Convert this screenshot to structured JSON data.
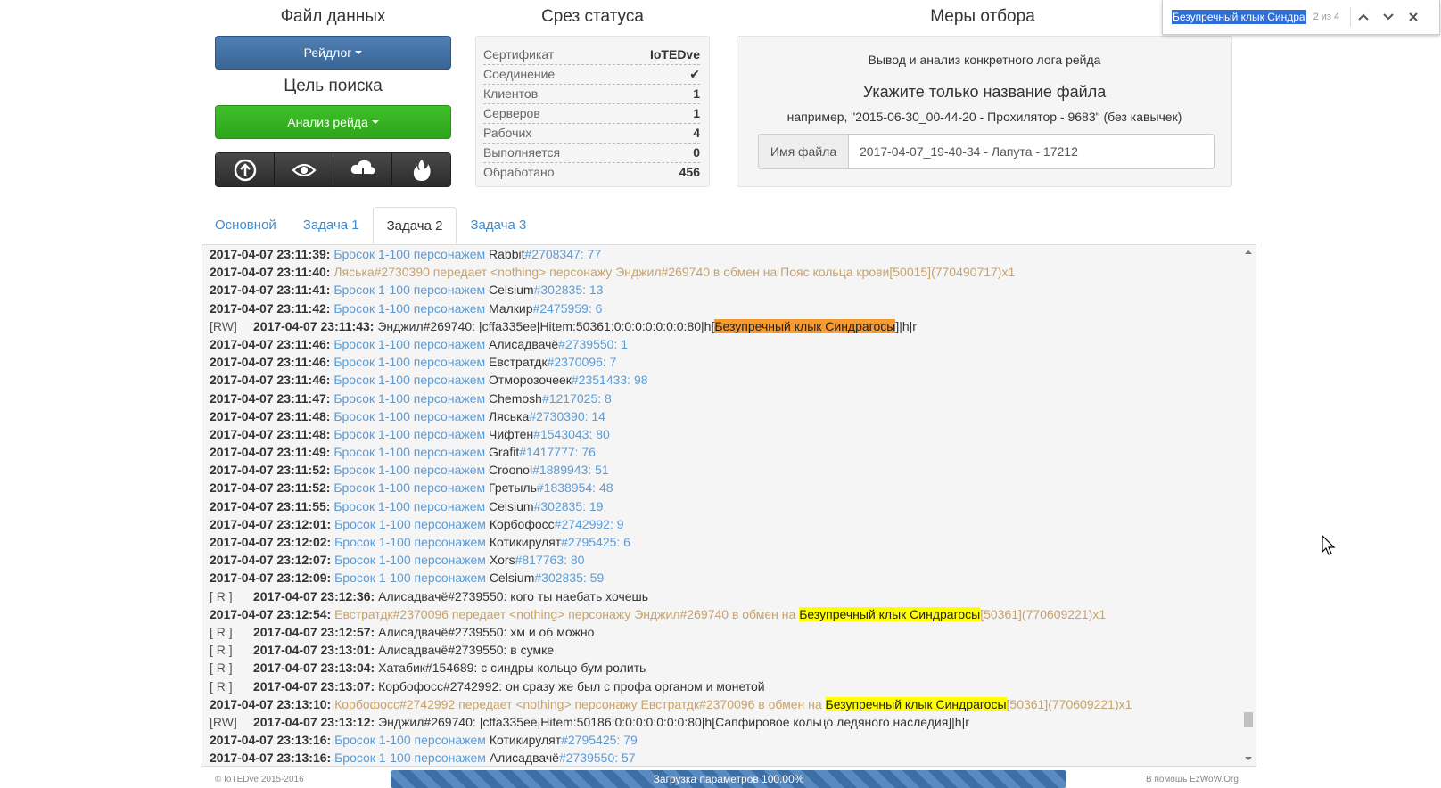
{
  "findbar": {
    "query": "Безупречный клык Синдра",
    "count": "2 из 4"
  },
  "left": {
    "data_title": "Файл данных",
    "data_button": "Рейдлог",
    "search_title": "Цель поиска",
    "search_button": "Анализ рейда",
    "icons": [
      "upload-icon",
      "eye-icon",
      "cloud-download-icon",
      "fire-icon"
    ]
  },
  "status": {
    "title": "Срез статуса",
    "rows": [
      {
        "label": "Сертификат",
        "value": "IoTEDve"
      },
      {
        "label": "Соединение",
        "value": "✔"
      },
      {
        "label": "Клиентов",
        "value": "1"
      },
      {
        "label": "Серверов",
        "value": "1"
      },
      {
        "label": "Рабочих",
        "value": "4"
      },
      {
        "label": "Выполняется",
        "value": "0"
      },
      {
        "label": "Обработано",
        "value": "456"
      }
    ]
  },
  "filter": {
    "title": "Меры отбора",
    "desc": "Вывод и анализ конкретного лога рейда",
    "heading": "Укажите только название файла",
    "example": "например, \"2015-06-30_00-44-20 - Прохилятор - 9683\" (без кавычек)",
    "input_label": "Имя файла",
    "input_value": "2017-04-07_19-40-34 - Лапута - 17212"
  },
  "tabs": [
    "Основной",
    "Задача 1",
    "Задача 2",
    "Задача 3"
  ],
  "log": [
    {
      "tag": "",
      "ts": "2017-04-07 23:11:39:",
      "parts": [
        {
          "c": "blue",
          "t": " Бросок 1-100 персонажем "
        },
        {
          "c": "dark",
          "t": "Rabbit"
        },
        {
          "c": "blue",
          "t": "#2708347: 77"
        }
      ]
    },
    {
      "tag": "",
      "ts": "2017-04-07 23:11:40:",
      "parts": [
        {
          "c": "tan",
          "t": " Ляська#2730390 передает <nothing> персонажу Энджил#269740 в обмен на "
        },
        {
          "c": "tan",
          "t": "Пояс кольца крови[50015](770490717)x1"
        }
      ]
    },
    {
      "tag": "",
      "ts": "2017-04-07 23:11:41:",
      "parts": [
        {
          "c": "blue",
          "t": " Бросок 1-100 персонажем "
        },
        {
          "c": "dark",
          "t": "Celsium"
        },
        {
          "c": "blue",
          "t": "#302835: 13"
        }
      ]
    },
    {
      "tag": "",
      "ts": "2017-04-07 23:11:42:",
      "parts": [
        {
          "c": "blue",
          "t": " Бросок 1-100 персонажем "
        },
        {
          "c": "dark",
          "t": "Малкир"
        },
        {
          "c": "blue",
          "t": "#2475959: 6"
        }
      ]
    },
    {
      "tag": "[RW]",
      "ts": "2017-04-07 23:11:43:",
      "parts": [
        {
          "c": "dark",
          "t": " Энджил#269740: |cffa335ee|Hitem:50361:0:0:0:0:0:0:0:80|h["
        },
        {
          "c": "hl-orange",
          "t": "Безупречный клык Синдрагосы"
        },
        {
          "c": "dark",
          "t": "]|h|r"
        }
      ]
    },
    {
      "tag": "",
      "ts": "2017-04-07 23:11:46:",
      "parts": [
        {
          "c": "blue",
          "t": " Бросок 1-100 персонажем "
        },
        {
          "c": "dark",
          "t": "Алисадвачё"
        },
        {
          "c": "blue",
          "t": "#2739550: 1"
        }
      ]
    },
    {
      "tag": "",
      "ts": "2017-04-07 23:11:46:",
      "parts": [
        {
          "c": "blue",
          "t": " Бросок 1-100 персонажем "
        },
        {
          "c": "dark",
          "t": "Евстратдк"
        },
        {
          "c": "blue",
          "t": "#2370096: 7"
        }
      ]
    },
    {
      "tag": "",
      "ts": "2017-04-07 23:11:46:",
      "parts": [
        {
          "c": "blue",
          "t": " Бросок 1-100 персонажем "
        },
        {
          "c": "dark",
          "t": "Отморозочеек"
        },
        {
          "c": "blue",
          "t": "#2351433: 98"
        }
      ]
    },
    {
      "tag": "",
      "ts": "2017-04-07 23:11:47:",
      "parts": [
        {
          "c": "blue",
          "t": " Бросок 1-100 персонажем "
        },
        {
          "c": "dark",
          "t": "Chemosh"
        },
        {
          "c": "blue",
          "t": "#1217025: 8"
        }
      ]
    },
    {
      "tag": "",
      "ts": "2017-04-07 23:11:48:",
      "parts": [
        {
          "c": "blue",
          "t": " Бросок 1-100 персонажем "
        },
        {
          "c": "dark",
          "t": "Ляська"
        },
        {
          "c": "blue",
          "t": "#2730390: 14"
        }
      ]
    },
    {
      "tag": "",
      "ts": "2017-04-07 23:11:48:",
      "parts": [
        {
          "c": "blue",
          "t": " Бросок 1-100 персонажем "
        },
        {
          "c": "dark",
          "t": "Чифтен"
        },
        {
          "c": "blue",
          "t": "#1543043: 80"
        }
      ]
    },
    {
      "tag": "",
      "ts": "2017-04-07 23:11:49:",
      "parts": [
        {
          "c": "blue",
          "t": " Бросок 1-100 персонажем "
        },
        {
          "c": "dark",
          "t": "Grafit"
        },
        {
          "c": "blue",
          "t": "#1417777: 76"
        }
      ]
    },
    {
      "tag": "",
      "ts": "2017-04-07 23:11:52:",
      "parts": [
        {
          "c": "blue",
          "t": " Бросок 1-100 персонажем "
        },
        {
          "c": "dark",
          "t": "Croonol"
        },
        {
          "c": "blue",
          "t": "#1889943: 51"
        }
      ]
    },
    {
      "tag": "",
      "ts": "2017-04-07 23:11:52:",
      "parts": [
        {
          "c": "blue",
          "t": " Бросок 1-100 персонажем "
        },
        {
          "c": "dark",
          "t": "Гретыль"
        },
        {
          "c": "blue",
          "t": "#1838954: 48"
        }
      ]
    },
    {
      "tag": "",
      "ts": "2017-04-07 23:11:55:",
      "parts": [
        {
          "c": "blue",
          "t": " Бросок 1-100 персонажем "
        },
        {
          "c": "dark",
          "t": "Celsium"
        },
        {
          "c": "blue",
          "t": "#302835: 19"
        }
      ]
    },
    {
      "tag": "",
      "ts": "2017-04-07 23:12:01:",
      "parts": [
        {
          "c": "blue",
          "t": " Бросок 1-100 персонажем "
        },
        {
          "c": "dark",
          "t": "Корбофосс"
        },
        {
          "c": "blue",
          "t": "#2742992: 9"
        }
      ]
    },
    {
      "tag": "",
      "ts": "2017-04-07 23:12:02:",
      "parts": [
        {
          "c": "blue",
          "t": " Бросок 1-100 персонажем "
        },
        {
          "c": "dark",
          "t": "Котикирулят"
        },
        {
          "c": "blue",
          "t": "#2795425: 6"
        }
      ]
    },
    {
      "tag": "",
      "ts": "2017-04-07 23:12:07:",
      "parts": [
        {
          "c": "blue",
          "t": " Бросок 1-100 персонажем "
        },
        {
          "c": "dark",
          "t": "Xors"
        },
        {
          "c": "blue",
          "t": "#817763: 80"
        }
      ]
    },
    {
      "tag": "",
      "ts": "2017-04-07 23:12:09:",
      "parts": [
        {
          "c": "blue",
          "t": " Бросок 1-100 персонажем "
        },
        {
          "c": "dark",
          "t": "Celsium"
        },
        {
          "c": "blue",
          "t": "#302835: 59"
        }
      ]
    },
    {
      "tag": "[ R ]",
      "ts": "2017-04-07 23:12:36:",
      "parts": [
        {
          "c": "dark",
          "t": " Алисадвачё#2739550: кого ты наебать хочешь"
        }
      ]
    },
    {
      "tag": "",
      "ts": "2017-04-07 23:12:54:",
      "parts": [
        {
          "c": "tan",
          "t": " Евстратдк#2370096 передает <nothing> персонажу Энджил#269740 в обмен на "
        },
        {
          "c": "hl-yellow",
          "t": "Безупречный клык Синдрагосы"
        },
        {
          "c": "tan",
          "t": "[50361](770609221)x1"
        }
      ]
    },
    {
      "tag": "[ R ]",
      "ts": "2017-04-07 23:12:57:",
      "parts": [
        {
          "c": "dark",
          "t": " Алисадвачё#2739550: хм и об можно"
        }
      ]
    },
    {
      "tag": "[ R ]",
      "ts": "2017-04-07 23:13:01:",
      "parts": [
        {
          "c": "dark",
          "t": " Алисадвачё#2739550: в сумке"
        }
      ]
    },
    {
      "tag": "[ R ]",
      "ts": "2017-04-07 23:13:04:",
      "parts": [
        {
          "c": "dark",
          "t": " Хатабик#154689: с синдры кольцо бум ролить"
        }
      ]
    },
    {
      "tag": "[ R ]",
      "ts": "2017-04-07 23:13:07:",
      "parts": [
        {
          "c": "dark",
          "t": " Корбофосс#2742992: он сразу же был с профа органом и монетой"
        }
      ]
    },
    {
      "tag": "",
      "ts": "2017-04-07 23:13:10:",
      "parts": [
        {
          "c": "tan",
          "t": " Корбофосс#2742992 передает <nothing> персонажу Евстратдк#2370096 в обмен на "
        },
        {
          "c": "hl-yellow",
          "t": "Безупречный клык Синдрагосы"
        },
        {
          "c": "tan",
          "t": "[50361](770609221)x1"
        }
      ]
    },
    {
      "tag": "[RW]",
      "ts": "2017-04-07 23:13:12:",
      "parts": [
        {
          "c": "dark",
          "t": " Энджил#269740: |cffa335ee|Hitem:50186:0:0:0:0:0:0:0:80|h[Сапфировое кольцо ледяного наследия]|h|r"
        }
      ]
    },
    {
      "tag": "",
      "ts": "2017-04-07 23:13:16:",
      "parts": [
        {
          "c": "blue",
          "t": " Бросок 1-100 персонажем "
        },
        {
          "c": "dark",
          "t": "Котикирулят"
        },
        {
          "c": "blue",
          "t": "#2795425: 79"
        }
      ]
    },
    {
      "tag": "",
      "ts": "2017-04-07 23:13:16:",
      "parts": [
        {
          "c": "blue",
          "t": " Бросок 1-100 персонажем "
        },
        {
          "c": "dark",
          "t": "Алисадвачё"
        },
        {
          "c": "blue",
          "t": "#2739550: 57"
        }
      ]
    }
  ],
  "footer": {
    "copyright": "© IoTEDve 2015-2016",
    "progress_label": "Загрузка параметров 100.00%",
    "progress": 1.0,
    "help": "В помощь EzWoW.Org"
  }
}
